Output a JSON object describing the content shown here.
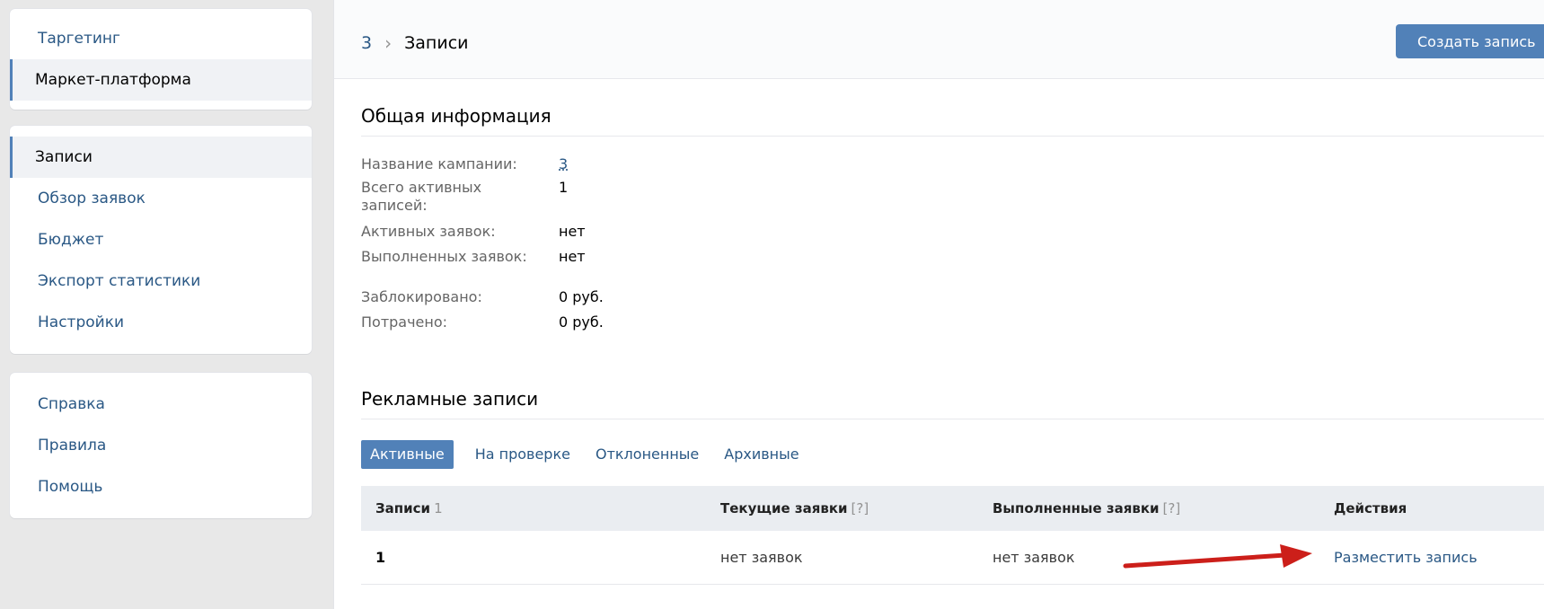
{
  "sidebar": {
    "top_items": [
      {
        "label": "Таргетинг",
        "active": false
      },
      {
        "label": "Маркет-платформа",
        "active": true
      }
    ],
    "nav_items": [
      {
        "label": "Записи",
        "active": true
      },
      {
        "label": "Обзор заявок",
        "active": false
      },
      {
        "label": "Бюджет",
        "active": false
      },
      {
        "label": "Экспорт статистики",
        "active": false
      },
      {
        "label": "Настройки",
        "active": false
      }
    ],
    "help_items": [
      {
        "label": "Справка"
      },
      {
        "label": "Правила"
      },
      {
        "label": "Помощь"
      }
    ]
  },
  "header": {
    "breadcrumb_parent": "3",
    "breadcrumb_separator": "›",
    "breadcrumb_current": "Записи",
    "create_button": "Создать запись"
  },
  "general_info": {
    "title": "Общая информация",
    "rows": [
      {
        "label": "Название кампании:",
        "value": "3"
      },
      {
        "label": "Всего активных записей:",
        "value": "1"
      },
      {
        "label": "Активных заявок:",
        "value": "нет"
      },
      {
        "label": "Выполненных заявок:",
        "value": "нет"
      },
      {
        "label": "Заблокировано:",
        "value": "0 руб."
      },
      {
        "label": "Потрачено:",
        "value": "0 руб."
      }
    ]
  },
  "ads": {
    "title": "Рекламные записи",
    "tabs": [
      {
        "label": "Активные",
        "active": true
      },
      {
        "label": "На проверке",
        "active": false
      },
      {
        "label": "Отклоненные",
        "active": false
      },
      {
        "label": "Архивные",
        "active": false
      }
    ],
    "columns": {
      "posts": "Записи",
      "posts_count": "1",
      "current_requests": "Текущие заявки",
      "completed_requests": "Выполненные заявки",
      "hint": "[?]",
      "actions": "Действия"
    },
    "rows": [
      {
        "post": "1",
        "current_requests": "нет заявок",
        "completed_requests": "нет заявок",
        "action": "Разместить запись"
      }
    ]
  },
  "colors": {
    "accent": "#5181b8",
    "link": "#2a5885",
    "annotation_arrow": "#cc1f1a"
  }
}
